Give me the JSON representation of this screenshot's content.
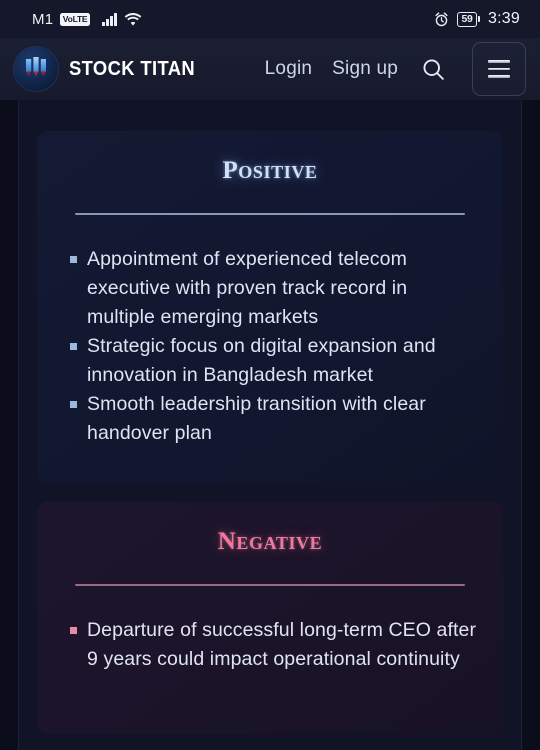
{
  "statusbar": {
    "carrier": "M1",
    "volte_badge": "VoLTE",
    "signal_icon": "signal-bars-icon",
    "wifi_icon": "wifi-icon",
    "alarm_icon": "alarm-clock-icon",
    "battery_percent": "59",
    "time": "3:39"
  },
  "header": {
    "logo_icon": "stock-titan-logo-icon",
    "brand_name": "STOCK TITAN",
    "login_label": "Login",
    "signup_label": "Sign up",
    "search_icon": "search-icon",
    "menu_icon": "hamburger-menu-icon"
  },
  "cards": [
    {
      "id": "positive",
      "title": "Positive",
      "accent_color": "#cfe0fa",
      "divider_color": "#8c96b4",
      "bullet_color": "#9fb6dd",
      "items": [
        "Appointment of experienced telecom executive with proven track record in multiple emerging markets",
        "Strategic focus on digital expansion and innovation in Bangladesh market",
        "Smooth leadership transition with clear handover plan"
      ]
    },
    {
      "id": "negative",
      "title": "Negative",
      "accent_color": "#f2779c",
      "divider_color": "#9a6a84",
      "bullet_color": "#e88aa6",
      "items": [
        "Departure of successful long-term CEO after 9 years could impact operational continuity"
      ]
    }
  ]
}
